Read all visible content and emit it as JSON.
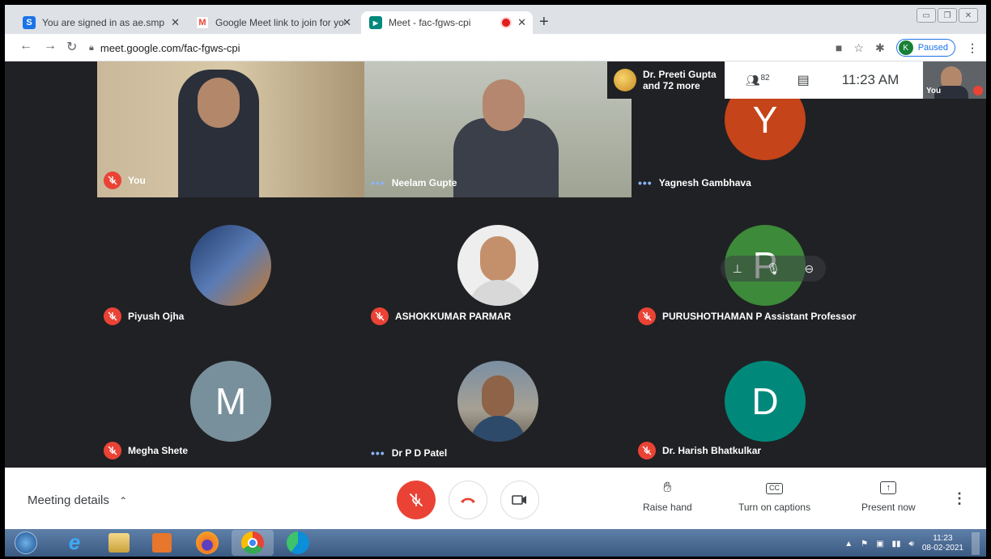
{
  "browser": {
    "tabs": [
      {
        "title": "You are signed in as ae.smp",
        "favicon": "S",
        "favicon_color": "#1a73e8"
      },
      {
        "title": "Google Meet link to join for your",
        "favicon": "M",
        "favicon_color": "#ea4335"
      },
      {
        "title": "Meet - fac-fgws-cpi",
        "favicon": "▶",
        "favicon_color": "#00897b"
      }
    ],
    "url": "meet.google.com/fac-fgws-cpi",
    "profile_initial": "K",
    "profile_status": "Paused"
  },
  "meeting": {
    "participants_label": {
      "line1": "Dr. Preeti Gupta",
      "line2": "and 72 more"
    },
    "participant_count": "82",
    "time": "11:23 AM",
    "self_label": "You",
    "tiles": [
      {
        "name": "You",
        "state": "muted"
      },
      {
        "name": "Neelam Gupte",
        "state": "speaking"
      },
      {
        "name": "Yagnesh Gambhava",
        "state": "speaking",
        "initial": "Y",
        "color": "#c5441a"
      },
      {
        "name": "Piyush Ojha",
        "state": "muted"
      },
      {
        "name": "ASHOKKUMAR PARMAR",
        "state": "muted"
      },
      {
        "name": "PURUSHOTHAMAN P Assistant Professor",
        "state": "muted",
        "initial": "P",
        "color": "#3c8a3a"
      },
      {
        "name": "Megha Shete",
        "state": "muted",
        "initial": "M",
        "color": "#78909c"
      },
      {
        "name": "Dr P D Patel",
        "state": "speaking"
      },
      {
        "name": "Dr. Harish Bhatkulkar",
        "state": "muted",
        "initial": "D",
        "color": "#00897b"
      }
    ]
  },
  "controls": {
    "meeting_details": "Meeting details",
    "raise_hand": "Raise hand",
    "captions": "Turn on captions",
    "present": "Present now",
    "captions_icon": "CC"
  },
  "taskbar": {
    "time": "11:23",
    "date": "08-02-2021"
  }
}
